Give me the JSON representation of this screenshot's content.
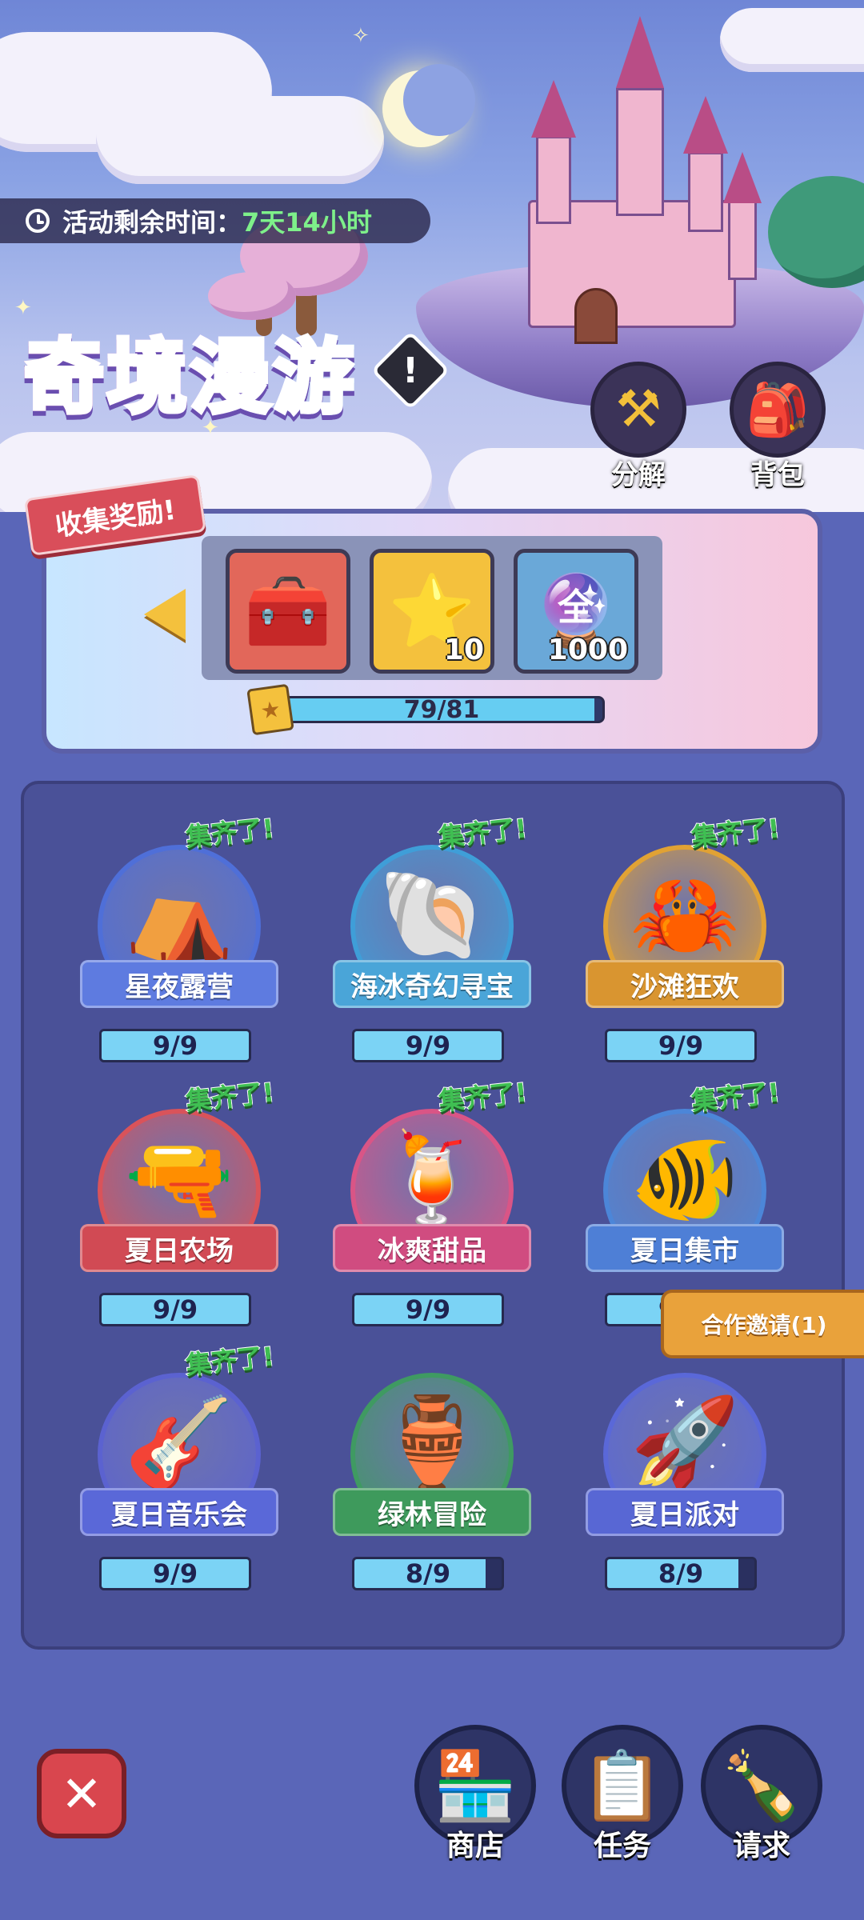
{
  "event": {
    "timer_label": "活动剩余时间：",
    "timer_value": "7天14小时",
    "title": "奇境漫游",
    "info_icon": "!"
  },
  "top_buttons": [
    {
      "label": "分解",
      "icon": "hammer-icon",
      "glyph": "⚒"
    },
    {
      "label": "背包",
      "icon": "backpack-icon",
      "glyph": "🎒"
    }
  ],
  "collection": {
    "ribbon_label": "收集奖励!",
    "rewards": [
      {
        "icon": "treasure-chest-icon",
        "glyph": "🧰",
        "count": "",
        "bg": "#e2675a"
      },
      {
        "icon": "star-icon",
        "glyph": "⭐",
        "count": "10",
        "bg": "#f4c13d"
      },
      {
        "icon": "crystal-orb-icon",
        "glyph": "🔮",
        "count": "1000",
        "bg": "#6aa8d8",
        "label": "全"
      }
    ],
    "progress_text": "79/81",
    "progress_value": 79,
    "progress_max": 81
  },
  "complete_tag": "集齐了!",
  "albums": [
    {
      "name": "星夜露营",
      "count": "9/9",
      "fraction": 1.0,
      "complete": true,
      "icon": "tent-icon",
      "glyph": "⛺",
      "ring": "#4f6fd8",
      "banner": "#5e7be0"
    },
    {
      "name": "海冰奇幻寻宝",
      "count": "9/9",
      "fraction": 1.0,
      "complete": true,
      "icon": "shell-icon",
      "glyph": "🐚",
      "ring": "#3f9ed8",
      "banner": "#4aa5d8"
    },
    {
      "name": "沙滩狂欢",
      "count": "9/9",
      "fraction": 1.0,
      "complete": true,
      "icon": "sand-bucket-icon",
      "glyph": "🦀",
      "ring": "#e1a234",
      "banner": "#d99530"
    },
    {
      "name": "夏日农场",
      "count": "9/9",
      "fraction": 1.0,
      "complete": true,
      "icon": "water-gun-icon",
      "glyph": "🔫",
      "ring": "#d9535a",
      "banner": "#d14a54"
    },
    {
      "name": "冰爽甜品",
      "count": "9/9",
      "fraction": 1.0,
      "complete": true,
      "icon": "drink-icon",
      "glyph": "🍹",
      "ring": "#d95586",
      "banner": "#d04c80"
    },
    {
      "name": "夏日集市",
      "count": "9/9",
      "fraction": 1.0,
      "complete": true,
      "icon": "goldfish-net-icon",
      "glyph": "🐠",
      "ring": "#4c86d8",
      "banner": "#4e7fd6"
    },
    {
      "name": "夏日音乐会",
      "count": "9/9",
      "fraction": 1.0,
      "complete": true,
      "icon": "guitar-icon",
      "glyph": "🎸",
      "ring": "#5b62d0",
      "banner": "#5a68d8"
    },
    {
      "name": "绿林冒险",
      "count": "8/9",
      "fraction": 0.889,
      "complete": false,
      "icon": "firefly-jar-icon",
      "glyph": "🏺",
      "ring": "#3f9a62",
      "banner": "#3e9a5c"
    },
    {
      "name": "夏日派对",
      "count": "8/9",
      "fraction": 0.889,
      "complete": false,
      "icon": "firework-rocket-icon",
      "glyph": "🚀",
      "ring": "#5a68d8",
      "banner": "#5867d4"
    }
  ],
  "invite_label": "合作邀请(1)",
  "bottom_buttons": [
    {
      "label": "商店",
      "icon": "shop-icon",
      "glyph": "🏪"
    },
    {
      "label": "任务",
      "icon": "task-clipboard-icon",
      "glyph": "📋"
    },
    {
      "label": "请求",
      "icon": "bottle-message-icon",
      "glyph": "🍾"
    }
  ],
  "close_icon": "✕"
}
